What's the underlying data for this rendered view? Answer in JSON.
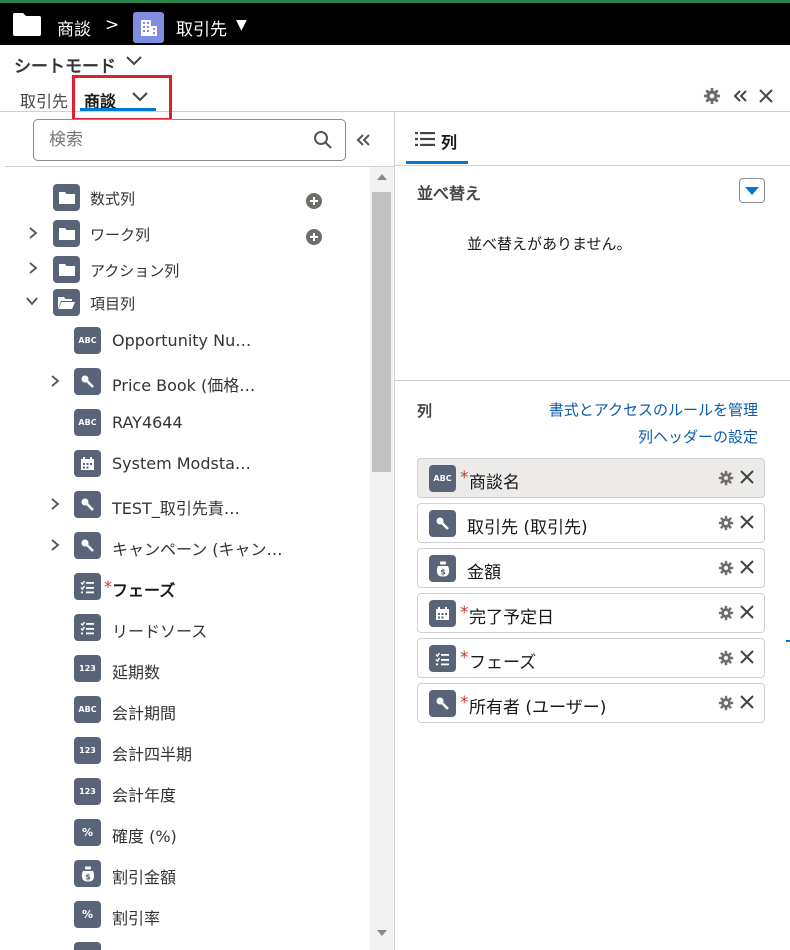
{
  "breadcrumb": {
    "deal": "商談",
    "separator": ">",
    "account": "取引先",
    "caret": "▼"
  },
  "sheet_mode": {
    "label": "シートモード"
  },
  "tabs": {
    "account": "取引先",
    "deal": "商談"
  },
  "search": {
    "placeholder": "検索"
  },
  "tree": {
    "folders": [
      {
        "label": "数式列",
        "expandable": false,
        "add": true
      },
      {
        "label": "ワーク列",
        "expandable": true,
        "add": true
      },
      {
        "label": "アクション列",
        "expandable": true,
        "add": false
      },
      {
        "label": "項目列",
        "expandable": true,
        "expanded": true,
        "add": false
      }
    ],
    "fields": [
      {
        "icon": "text-icon",
        "icon_text": "ABC",
        "label": "Opportunity Nu…",
        "required": false,
        "expandable": false
      },
      {
        "icon": "lookup-icon",
        "label": "Price Book (価格…",
        "required": false,
        "expandable": true
      },
      {
        "icon": "text-icon",
        "icon_text": "ABC",
        "label": "RAY4644",
        "required": false,
        "expandable": false
      },
      {
        "icon": "calendar-icon",
        "label": "System Modsta…",
        "required": false,
        "expandable": false
      },
      {
        "icon": "lookup-icon",
        "label": "TEST_取引先責…",
        "required": false,
        "expandable": true
      },
      {
        "icon": "lookup-icon",
        "label": "キャンペーン (キャン…",
        "required": false,
        "expandable": true
      },
      {
        "icon": "picklist-icon",
        "label": "フェーズ",
        "required": true,
        "bold": true,
        "expandable": false
      },
      {
        "icon": "picklist-icon",
        "label": "リードソース",
        "required": false,
        "expandable": false
      },
      {
        "icon": "number-icon",
        "icon_text": "123",
        "label": "延期数",
        "required": false,
        "expandable": false
      },
      {
        "icon": "text-icon",
        "icon_text": "ABC",
        "label": "会計期間",
        "required": false,
        "expandable": false
      },
      {
        "icon": "number-icon",
        "icon_text": "123",
        "label": "会計四半期",
        "required": false,
        "expandable": false
      },
      {
        "icon": "number-icon",
        "icon_text": "123",
        "label": "会計年度",
        "required": false,
        "expandable": false
      },
      {
        "icon": "percent-icon",
        "icon_text": "%",
        "label": "確度 (%)",
        "required": false,
        "expandable": false
      },
      {
        "icon": "currency-icon",
        "label": "割引金額",
        "required": false,
        "expandable": false
      },
      {
        "icon": "percent-icon",
        "icon_text": "%",
        "label": "割引率",
        "required": false,
        "expandable": false
      }
    ]
  },
  "right": {
    "tab_label": "列",
    "sort": {
      "title": "並べ替え",
      "empty": "並べ替えがありません。"
    },
    "columns": {
      "title": "列",
      "link_manage": "書式とアクセスのルールを管理",
      "link_header": "列ヘッダーの設定",
      "items": [
        {
          "icon": "text-icon",
          "icon_text": "ABC",
          "label": "商談名",
          "required": true,
          "selected": true
        },
        {
          "icon": "lookup-icon",
          "label": "取引先 (取引先)",
          "required": false
        },
        {
          "icon": "currency-icon",
          "label": "金額",
          "required": false
        },
        {
          "icon": "calendar-icon",
          "label": "完了予定日",
          "required": true
        },
        {
          "icon": "picklist-icon",
          "label": "フェーズ",
          "required": true
        },
        {
          "icon": "lookup-icon",
          "label": "所有者 (ユーザー)",
          "required": true
        }
      ]
    }
  },
  "colors": {
    "topbar": "#000000",
    "accent": "#0176d3",
    "icon_bg": "#5a6478",
    "required": "#c23934",
    "link": "#0b5cab",
    "highlight_box": "#e0202d"
  }
}
